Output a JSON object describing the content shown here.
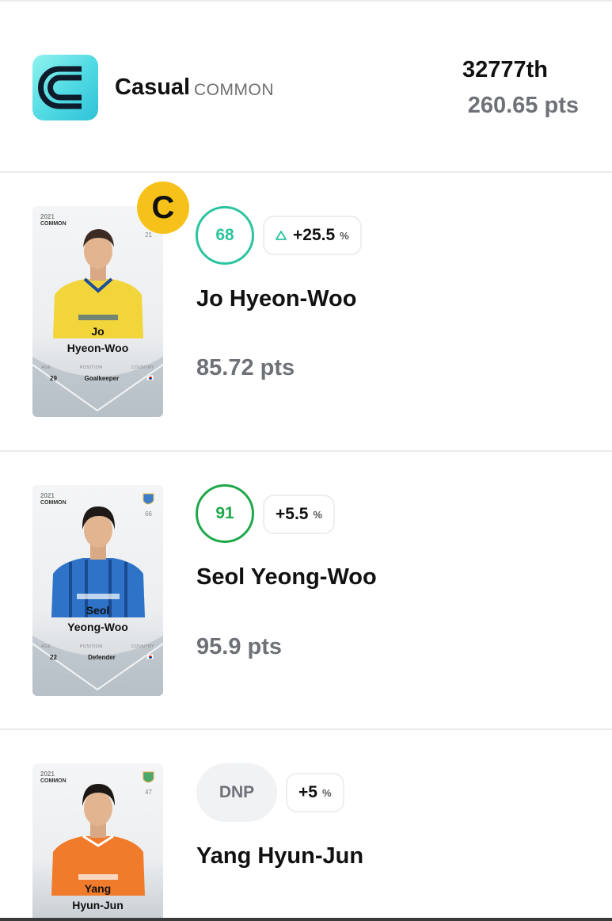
{
  "league": {
    "name": "Casual",
    "rarity": "COMMON",
    "rank": "32777th",
    "total_points": "260.65 pts",
    "logo_icon": "league-c-logo-icon"
  },
  "players": [
    {
      "name": "Jo Hyeon-Woo",
      "card": {
        "season": "2021",
        "rarity": "COMMON",
        "number": "21",
        "first": "Jo",
        "last": "Hyeon-Woo",
        "age_label": "AGE",
        "position_label": "POSITION",
        "country_label": "COUNTRY",
        "age": "29",
        "position": "Goalkeeper"
      },
      "captain": "C",
      "score": "68",
      "bonus": "+25.5",
      "bonus_unit": "%",
      "points": "85.72 pts",
      "shirt_color": "#f2d43b"
    },
    {
      "name": "Seol Yeong-Woo",
      "card": {
        "season": "2021",
        "rarity": "COMMON",
        "number": "66",
        "first": "Seol",
        "last": "Yeong-Woo",
        "age_label": "AGE",
        "position_label": "POSITION",
        "country_label": "COUNTRY",
        "age": "22",
        "position": "Defender"
      },
      "score": "91",
      "bonus": "+5.5",
      "bonus_unit": "%",
      "points": "95.9 pts",
      "shirt_color": "#2e73c8"
    },
    {
      "name": "Yang Hyun-Jun",
      "card": {
        "season": "2021",
        "rarity": "COMMON",
        "number": "47",
        "first": "Yang",
        "last": "Hyun-Jun"
      },
      "score": "DNP",
      "bonus": "+5",
      "bonus_unit": "%",
      "shirt_color": "#f07b2a"
    }
  ],
  "colors": {
    "score_teal": "#2cc4a0",
    "score_green": "#1fa84a",
    "captain_yellow": "#f6c21a",
    "muted_text": "#6e7177"
  }
}
